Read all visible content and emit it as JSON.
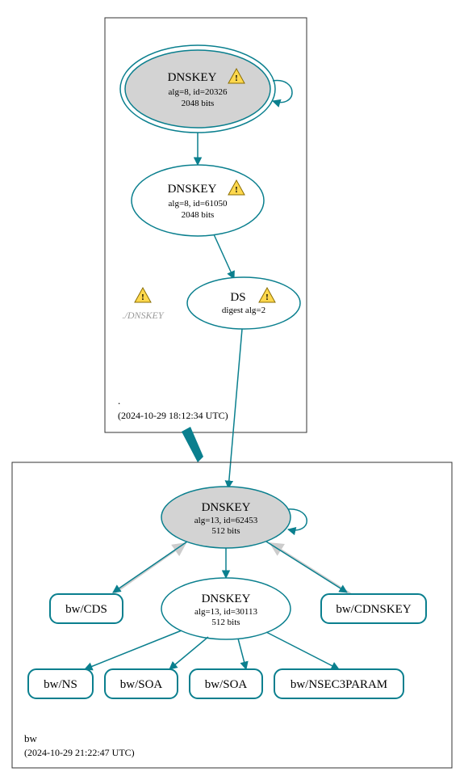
{
  "zones": {
    "root": {
      "name": ".",
      "timestamp": "(2024-10-29 18:12:34 UTC)",
      "nodes": {
        "ksk": {
          "title": "DNSKEY",
          "line1": "alg=8, id=20326",
          "line2": "2048 bits",
          "warning": true,
          "double_border": true,
          "fill": "grey"
        },
        "zsk": {
          "title": "DNSKEY",
          "line1": "alg=8, id=61050",
          "line2": "2048 bits",
          "warning": true,
          "double_border": false,
          "fill": "white"
        },
        "ds": {
          "title": "DS",
          "line1": "digest alg=2",
          "warning": true,
          "double_border": false,
          "fill": "white"
        },
        "placeholder": {
          "label": "./DNSKEY",
          "warning": true
        }
      }
    },
    "bw": {
      "name": "bw",
      "timestamp": "(2024-10-29 21:22:47 UTC)",
      "nodes": {
        "ksk": {
          "title": "DNSKEY",
          "line1": "alg=13, id=62453",
          "line2": "512 bits",
          "warning": false,
          "double_border": false,
          "fill": "grey"
        },
        "zsk": {
          "title": "DNSKEY",
          "line1": "alg=13, id=30113",
          "line2": "512 bits",
          "warning": false,
          "double_border": false,
          "fill": "white"
        }
      },
      "rrsets": {
        "cds": "bw/CDS",
        "cdnskey": "bw/CDNSKEY",
        "ns": "bw/NS",
        "soa1": "bw/SOA",
        "soa2": "bw/SOA",
        "nsec3param": "bw/NSEC3PARAM"
      }
    }
  }
}
